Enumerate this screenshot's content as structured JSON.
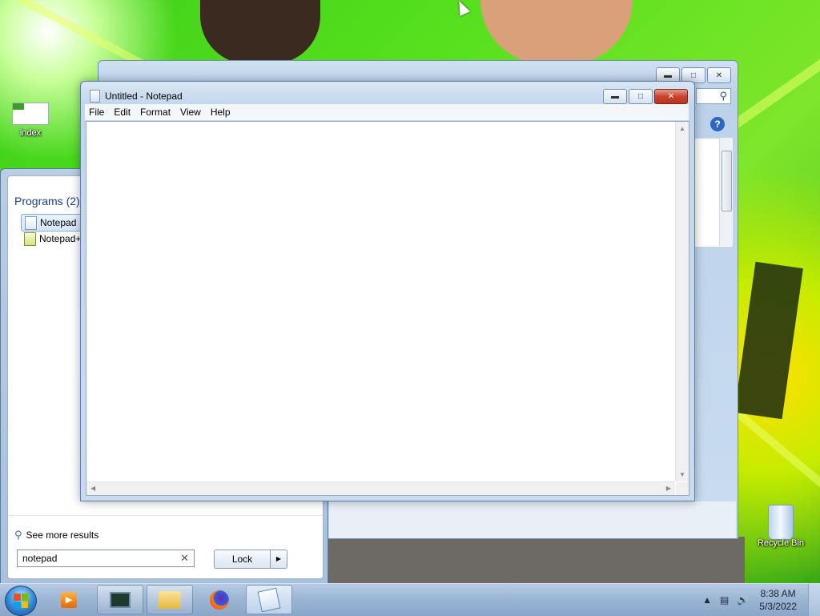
{
  "desktop": {
    "icons": [
      {
        "label": "index",
        "icon": "image-file-icon"
      },
      {
        "label": "Recycle Bin",
        "icon": "recycle-bin-icon"
      }
    ]
  },
  "notepad": {
    "title": "Untitled - Notepad",
    "menu": [
      "File",
      "Edit",
      "Format",
      "View",
      "Help"
    ],
    "content": ""
  },
  "start_menu": {
    "programs_heading": "Programs (2)",
    "programs": [
      {
        "label": "Notepad",
        "icon": "notepad-icon",
        "selected": true
      },
      {
        "label": "Notepad++",
        "icon": "notepadpp-icon",
        "selected": false
      }
    ],
    "see_more": "See more results",
    "search_value": "notepad",
    "lock_label": "Lock"
  },
  "taskbar": {
    "pinned": [
      "media-player-icon",
      "task-manager-icon",
      "file-explorer-icon",
      "firefox-icon",
      "notepad-icon"
    ],
    "clock_time": "8:38 AM",
    "clock_date": "5/3/2022"
  },
  "colors": {
    "wallpaper_green": "#57e01d",
    "start_heading": "#1e3f80",
    "close_red": "#c9442c"
  }
}
